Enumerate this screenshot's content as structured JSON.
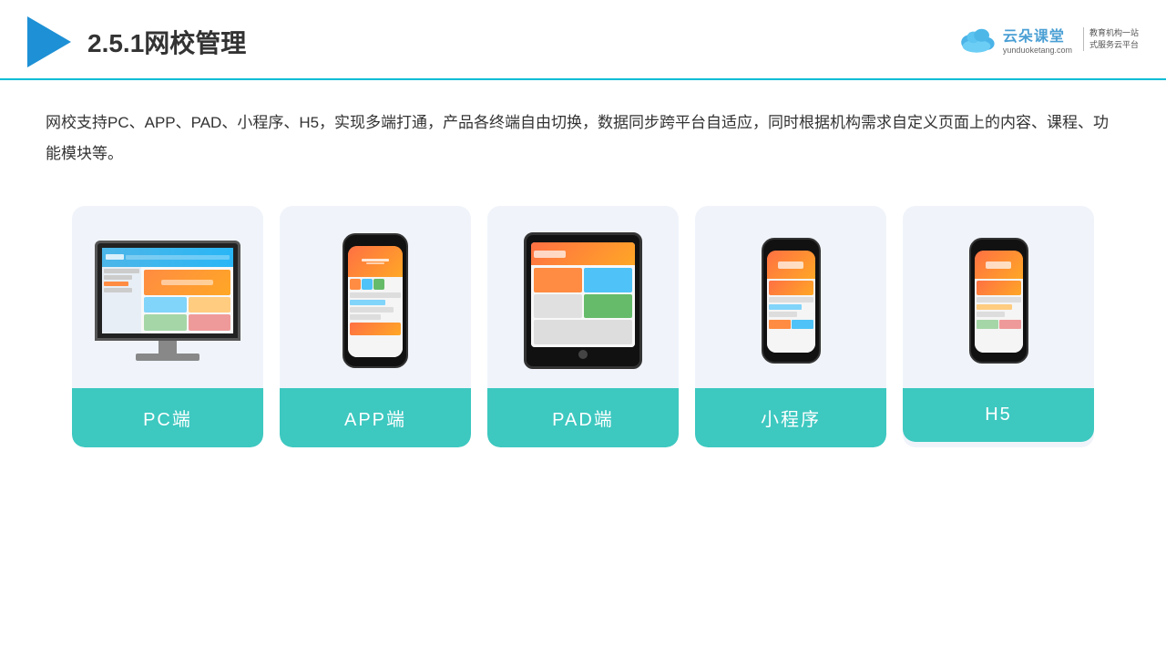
{
  "header": {
    "title": "2.5.1网校管理",
    "brand": {
      "name": "云朵课堂",
      "domain": "yunduoketang.com",
      "slogan_line1": "教育机构一站",
      "slogan_line2": "式服务云平台"
    }
  },
  "description": {
    "text": "网校支持PC、APP、PAD、小程序、H5，实现多端打通，产品各终端自由切换，数据同步跨平台自适应，同时根据机构需求自定义页面上的内容、课程、功能模块等。"
  },
  "cards": [
    {
      "id": "pc",
      "label": "PC端"
    },
    {
      "id": "app",
      "label": "APP端"
    },
    {
      "id": "pad",
      "label": "PAD端"
    },
    {
      "id": "mini",
      "label": "小程序"
    },
    {
      "id": "h5",
      "label": "H5"
    }
  ],
  "colors": {
    "accent": "#3dc8c0",
    "header_border": "#00bcd4",
    "card_bg": "#eef2f8",
    "title_color": "#333",
    "text_color": "#333"
  }
}
